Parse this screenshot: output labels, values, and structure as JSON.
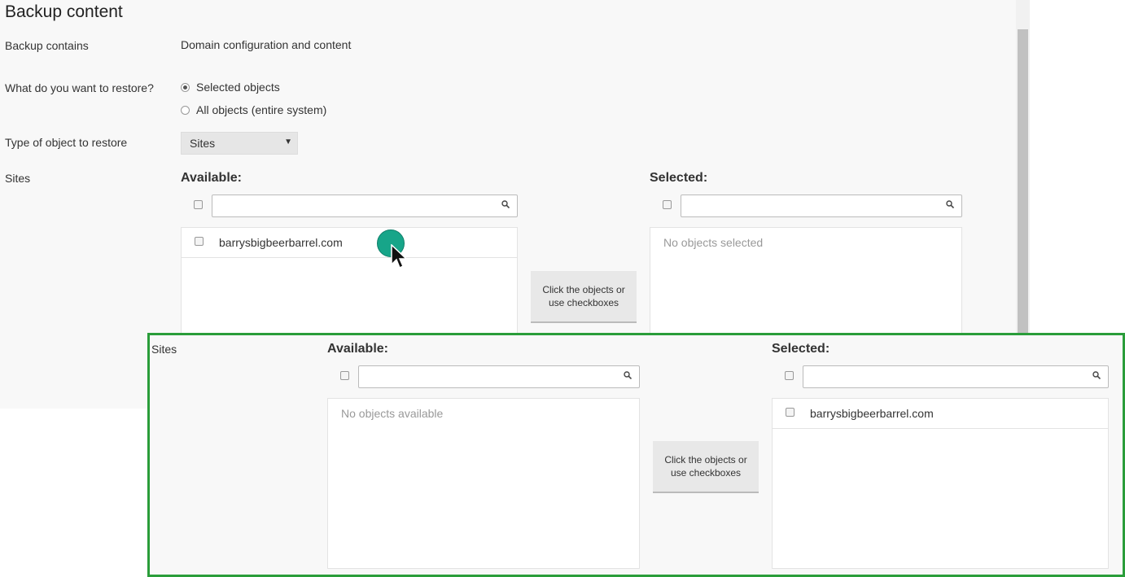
{
  "section": {
    "title": "Backup content"
  },
  "form": {
    "backup_contains_label": "Backup contains",
    "backup_contains_value": "Domain configuration and content",
    "restore_question_label": "What do you want to restore?",
    "restore_options": [
      "Selected objects",
      "All objects (entire system)"
    ],
    "restore_selected": "Selected objects",
    "type_label": "Type of object to restore",
    "type_value": "Sites",
    "sites_label": "Sites"
  },
  "picker": {
    "available_heading": "Available:",
    "selected_heading": "Selected:",
    "available_items": [
      "barrysbigbeerbarrel.com"
    ],
    "selected_empty": "No objects selected",
    "hint_button": "Click the objects or use checkboxes"
  },
  "zoom": {
    "sites_label": "Sites",
    "available_heading": "Available:",
    "selected_heading": "Selected:",
    "available_empty": "No objects available",
    "selected_items": [
      "barrysbigbeerbarrel.com"
    ],
    "hint_button": "Click the objects or use checkboxes"
  },
  "icons": {
    "search": "search-icon",
    "cursor": "mouse-pointer-icon",
    "dropdown": "triangle-down-icon"
  },
  "colors": {
    "highlight_border": "#2a9d3a",
    "cursor_dot": "#17a589"
  }
}
